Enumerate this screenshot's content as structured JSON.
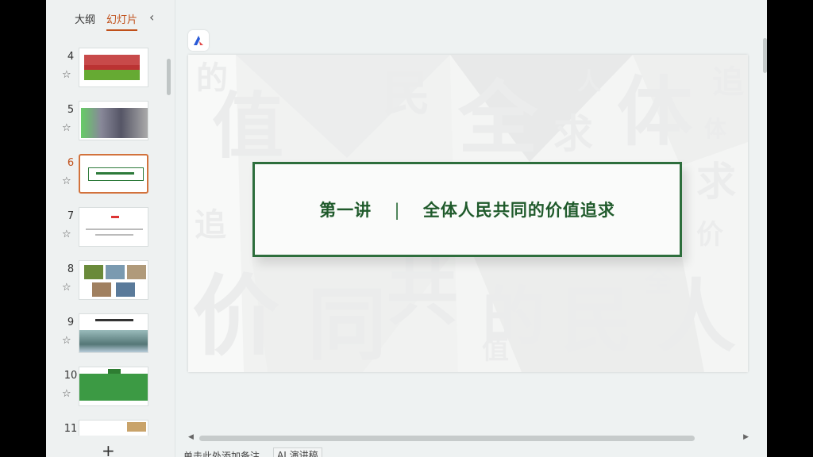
{
  "sidebar": {
    "tabs": [
      {
        "label": "大纲"
      },
      {
        "label": "幻灯片"
      }
    ],
    "active_tab": "幻灯片",
    "collapse_glyph": "‹",
    "add_glyph": "+",
    "slides": [
      {
        "number": "4"
      },
      {
        "number": "5"
      },
      {
        "number": "6"
      },
      {
        "number": "7"
      },
      {
        "number": "8"
      },
      {
        "number": "9"
      },
      {
        "number": "10"
      },
      {
        "number": "11"
      }
    ],
    "selected": "6"
  },
  "slide": {
    "title_part1": "第一讲",
    "separator": "|",
    "title_part2": "全体人民共同的价值追求",
    "background_chars": [
      "的",
      "值",
      "全",
      "民",
      "人",
      "追",
      "体",
      "求",
      "追",
      "共",
      "价",
      "同",
      "的",
      "民",
      "人",
      "全",
      "价",
      "值",
      "求",
      "体"
    ]
  },
  "footer": {
    "notes_placeholder": "单击此处添加备注",
    "ai_button": "AI 演讲稿"
  },
  "colors": {
    "accent": "#c0501a",
    "title_green": "#1f5a2b",
    "frame_green": "#2d6e3c"
  },
  "icons": {
    "ai_logo": "ai-logo-icon",
    "star": "star-icon"
  }
}
